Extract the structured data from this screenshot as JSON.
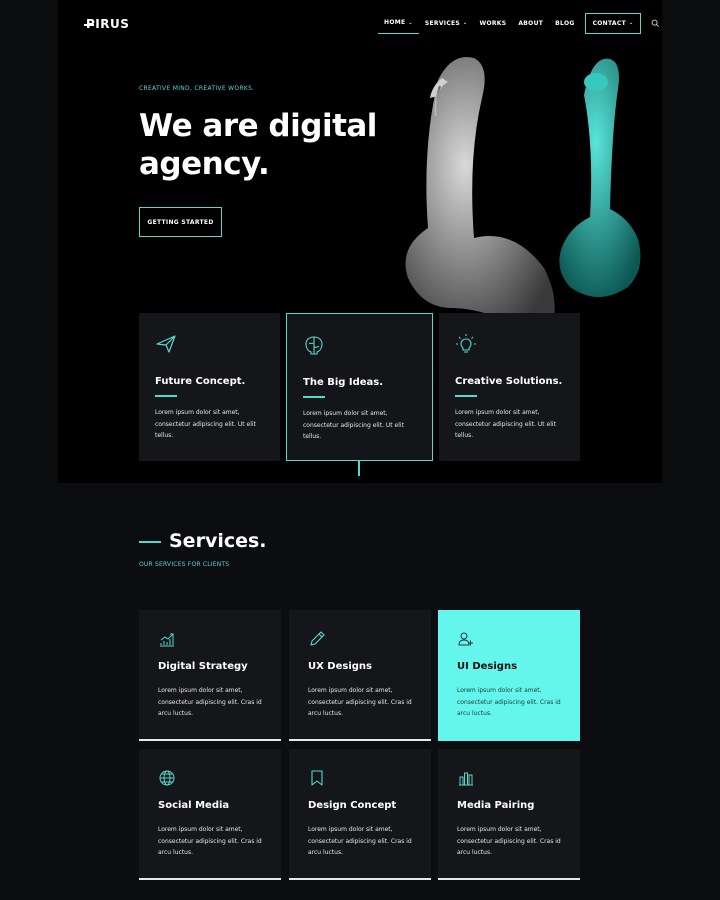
{
  "brand": {
    "logo": "PIRUS",
    "accent": "#56d8cf",
    "highlight": "#64f5ec"
  },
  "nav": {
    "items": [
      {
        "label": "HOME",
        "has_dropdown": true,
        "active": true
      },
      {
        "label": "SERVICES",
        "has_dropdown": true
      },
      {
        "label": "WORKS"
      },
      {
        "label": "ABOUT"
      },
      {
        "label": "BLOG"
      }
    ],
    "contact": {
      "label": "CONTACT",
      "has_dropdown": true
    },
    "search_icon": "search-icon"
  },
  "hero": {
    "tagline": "CREATIVE MIND, CREATIVE WORKS.",
    "headline": "We are digital agency.",
    "cta": "GETTING STARTED"
  },
  "features": [
    {
      "icon": "paper-plane-icon",
      "title": "Future Concept.",
      "desc": "Lorem ipsum dolor sit amet, consectetur adipiscing elit. Ut elit tellus."
    },
    {
      "icon": "brain-icon",
      "title": "The Big Ideas.",
      "desc": "Lorem ipsum dolor sit amet, consectetur adipiscing elit. Ut elit tellus."
    },
    {
      "icon": "lightbulb-icon",
      "title": "Creative Solutions.",
      "desc": "Lorem ipsum dolor sit amet, consectetur adipiscing elit. Ut elit tellus."
    }
  ],
  "services": {
    "title": "Services.",
    "subtitle": "OUR SERVICES FOR CLIENTS",
    "cards": [
      {
        "icon": "growth-chart-icon",
        "title": "Digital Strategy",
        "desc": "Lorem ipsum dolor sit amet, consectetur adipiscing elit. Cras id arcu luctus."
      },
      {
        "icon": "pencil-icon",
        "title": "UX Designs",
        "desc": "Lorem ipsum dolor sit amet, consectetur adipiscing elit. Cras id arcu luctus."
      },
      {
        "icon": "user-design-icon",
        "title": "UI Designs",
        "desc": "Lorem ipsum dolor sit amet, consectetur adipiscing elit. Cras id arcu luctus."
      },
      {
        "icon": "globe-icon",
        "title": "Social Media",
        "desc": "Lorem ipsum dolor sit amet, consectetur adipiscing elit. Cras id arcu luctus."
      },
      {
        "icon": "bookmark-icon",
        "title": "Design Concept",
        "desc": "Lorem ipsum dolor sit amet, consectetur adipiscing elit. Cras id arcu luctus."
      },
      {
        "icon": "bar-chart-icon",
        "title": "Media Pairing",
        "desc": "Lorem ipsum dolor sit amet, consectetur adipiscing elit. Cras id arcu luctus."
      }
    ]
  }
}
